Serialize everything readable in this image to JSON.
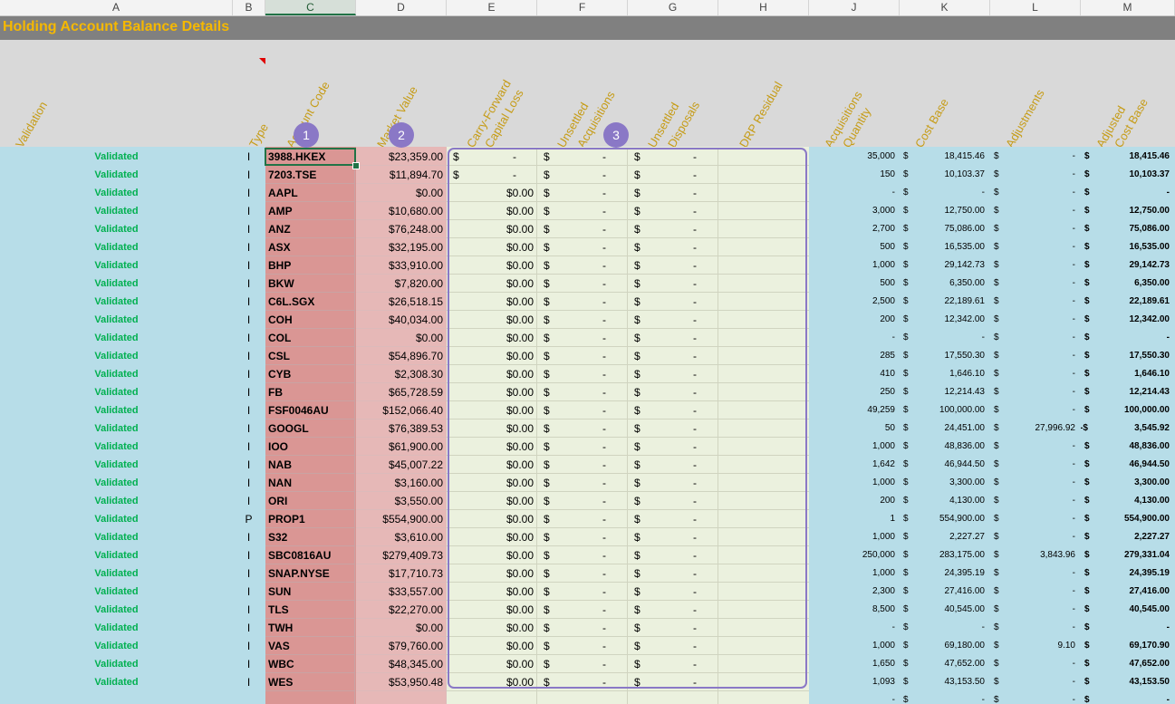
{
  "columns": [
    "A",
    "B",
    "C",
    "D",
    "E",
    "F",
    "G",
    "H",
    "J",
    "K",
    "L",
    "M"
  ],
  "title": "Holding Account Balance Details",
  "headers": {
    "validation": "Validation",
    "type": "Type",
    "account_code": "Account Code",
    "market_value": "Market Value",
    "carry_forward_1": "Carry-Forward",
    "carry_forward_2": "Capital Loss",
    "unsettled_acq_1": "Unsettled",
    "unsettled_acq_2": "Acquisitions",
    "unsettled_disp_1": "Unsettled",
    "unsettled_disp_2": "Disposals",
    "drp_residual": "DRP Residual",
    "acq_qty_1": "Acquisitions",
    "acq_qty_2": "Quantity",
    "cost_base": "Cost Base",
    "adjustments": "Adjustments",
    "adj_cost_1": "Adjusted",
    "adj_cost_2": "Cost Base"
  },
  "badges": [
    "1",
    "2",
    "3"
  ],
  "symbols": {
    "dollar": "$",
    "dash": "-",
    "neg_dollar": "-$"
  },
  "rows": [
    {
      "val": "Validated",
      "type": "I",
      "code": "3988.HKEX",
      "mv": "$23,359.00",
      "e": "dash",
      "qty": "35,000",
      "cost": "18,415.46",
      "adj": "-",
      "adjcost": "18,415.46"
    },
    {
      "val": "Validated",
      "type": "I",
      "code": "7203.TSE",
      "mv": "$11,894.70",
      "e": "dash",
      "qty": "150",
      "cost": "10,103.37",
      "adj": "-",
      "adjcost": "10,103.37"
    },
    {
      "val": "Validated",
      "type": "I",
      "code": "AAPL",
      "mv": "$0.00",
      "e": "$0.00",
      "qty": "-",
      "cost": "-",
      "adj": "-",
      "adjcost": "-"
    },
    {
      "val": "Validated",
      "type": "I",
      "code": "AMP",
      "mv": "$10,680.00",
      "e": "$0.00",
      "qty": "3,000",
      "cost": "12,750.00",
      "adj": "-",
      "adjcost": "12,750.00"
    },
    {
      "val": "Validated",
      "type": "I",
      "code": "ANZ",
      "mv": "$76,248.00",
      "e": "$0.00",
      "qty": "2,700",
      "cost": "75,086.00",
      "adj": "-",
      "adjcost": "75,086.00"
    },
    {
      "val": "Validated",
      "type": "I",
      "code": "ASX",
      "mv": "$32,195.00",
      "e": "$0.00",
      "qty": "500",
      "cost": "16,535.00",
      "adj": "-",
      "adjcost": "16,535.00"
    },
    {
      "val": "Validated",
      "type": "I",
      "code": "BHP",
      "mv": "$33,910.00",
      "e": "$0.00",
      "qty": "1,000",
      "cost": "29,142.73",
      "adj": "-",
      "adjcost": "29,142.73"
    },
    {
      "val": "Validated",
      "type": "I",
      "code": "BKW",
      "mv": "$7,820.00",
      "e": "$0.00",
      "qty": "500",
      "cost": "6,350.00",
      "adj": "-",
      "adjcost": "6,350.00"
    },
    {
      "val": "Validated",
      "type": "I",
      "code": "C6L.SGX",
      "mv": "$26,518.15",
      "e": "$0.00",
      "qty": "2,500",
      "cost": "22,189.61",
      "adj": "-",
      "adjcost": "22,189.61"
    },
    {
      "val": "Validated",
      "type": "I",
      "code": "COH",
      "mv": "$40,034.00",
      "e": "$0.00",
      "qty": "200",
      "cost": "12,342.00",
      "adj": "-",
      "adjcost": "12,342.00"
    },
    {
      "val": "Validated",
      "type": "I",
      "code": "COL",
      "mv": "$0.00",
      "e": "$0.00",
      "qty": "-",
      "cost": "-",
      "adj": "-",
      "adjcost": "-"
    },
    {
      "val": "Validated",
      "type": "I",
      "code": "CSL",
      "mv": "$54,896.70",
      "e": "$0.00",
      "qty": "285",
      "cost": "17,550.30",
      "adj": "-",
      "adjcost": "17,550.30"
    },
    {
      "val": "Validated",
      "type": "I",
      "code": "CYB",
      "mv": "$2,308.30",
      "e": "$0.00",
      "qty": "410",
      "cost": "1,646.10",
      "adj": "-",
      "adjcost": "1,646.10"
    },
    {
      "val": "Validated",
      "type": "I",
      "code": "FB",
      "mv": "$65,728.59",
      "e": "$0.00",
      "qty": "250",
      "cost": "12,214.43",
      "adj": "-",
      "adjcost": "12,214.43"
    },
    {
      "val": "Validated",
      "type": "I",
      "code": "FSF0046AU",
      "mv": "$152,066.40",
      "e": "$0.00",
      "qty": "49,259",
      "cost": "100,000.00",
      "adj": "-",
      "adjcost": "100,000.00"
    },
    {
      "val": "Validated",
      "type": "I",
      "code": "GOOGL",
      "mv": "$76,389.53",
      "e": "$0.00",
      "qty": "50",
      "cost": "24,451.00",
      "adj": "27,996.92",
      "adjcost": "3,545.92",
      "neg": true
    },
    {
      "val": "Validated",
      "type": "I",
      "code": "IOO",
      "mv": "$61,900.00",
      "e": "$0.00",
      "qty": "1,000",
      "cost": "48,836.00",
      "adj": "-",
      "adjcost": "48,836.00"
    },
    {
      "val": "Validated",
      "type": "I",
      "code": "NAB",
      "mv": "$45,007.22",
      "e": "$0.00",
      "qty": "1,642",
      "cost": "46,944.50",
      "adj": "-",
      "adjcost": "46,944.50"
    },
    {
      "val": "Validated",
      "type": "I",
      "code": "NAN",
      "mv": "$3,160.00",
      "e": "$0.00",
      "qty": "1,000",
      "cost": "3,300.00",
      "adj": "-",
      "adjcost": "3,300.00"
    },
    {
      "val": "Validated",
      "type": "I",
      "code": "ORI",
      "mv": "$3,550.00",
      "e": "$0.00",
      "qty": "200",
      "cost": "4,130.00",
      "adj": "-",
      "adjcost": "4,130.00"
    },
    {
      "val": "Validated",
      "type": "P",
      "code": "PROP1",
      "mv": "$554,900.00",
      "e": "$0.00",
      "qty": "1",
      "cost": "554,900.00",
      "adj": "-",
      "adjcost": "554,900.00"
    },
    {
      "val": "Validated",
      "type": "I",
      "code": "S32",
      "mv": "$3,610.00",
      "e": "$0.00",
      "qty": "1,000",
      "cost": "2,227.27",
      "adj": "-",
      "adjcost": "2,227.27"
    },
    {
      "val": "Validated",
      "type": "I",
      "code": "SBC0816AU",
      "mv": "$279,409.73",
      "e": "$0.00",
      "qty": "250,000",
      "cost": "283,175.00",
      "adj": "3,843.96",
      "adjcost": "279,331.04"
    },
    {
      "val": "Validated",
      "type": "I",
      "code": "SNAP.NYSE",
      "mv": "$17,710.73",
      "e": "$0.00",
      "qty": "1,000",
      "cost": "24,395.19",
      "adj": "-",
      "adjcost": "24,395.19"
    },
    {
      "val": "Validated",
      "type": "I",
      "code": "SUN",
      "mv": "$33,557.00",
      "e": "$0.00",
      "qty": "2,300",
      "cost": "27,416.00",
      "adj": "-",
      "adjcost": "27,416.00"
    },
    {
      "val": "Validated",
      "type": "I",
      "code": "TLS",
      "mv": "$22,270.00",
      "e": "$0.00",
      "qty": "8,500",
      "cost": "40,545.00",
      "adj": "-",
      "adjcost": "40,545.00"
    },
    {
      "val": "Validated",
      "type": "I",
      "code": "TWH",
      "mv": "$0.00",
      "e": "$0.00",
      "qty": "-",
      "cost": "-",
      "adj": "-",
      "adjcost": "-"
    },
    {
      "val": "Validated",
      "type": "I",
      "code": "VAS",
      "mv": "$79,760.00",
      "e": "$0.00",
      "qty": "1,000",
      "cost": "69,180.00",
      "adj": "9.10",
      "adjcost": "69,170.90"
    },
    {
      "val": "Validated",
      "type": "I",
      "code": "WBC",
      "mv": "$48,345.00",
      "e": "$0.00",
      "qty": "1,650",
      "cost": "47,652.00",
      "adj": "-",
      "adjcost": "47,652.00"
    },
    {
      "val": "Validated",
      "type": "I",
      "code": "WES",
      "mv": "$53,950.48",
      "e": "$0.00",
      "qty": "1,093",
      "cost": "43,153.50",
      "adj": "-",
      "adjcost": "43,153.50"
    },
    {
      "val": "",
      "type": "",
      "code": "",
      "mv": "",
      "e": "",
      "qty": "-",
      "cost": "-",
      "adj": "-",
      "adjcost": "-",
      "blank": true
    }
  ]
}
